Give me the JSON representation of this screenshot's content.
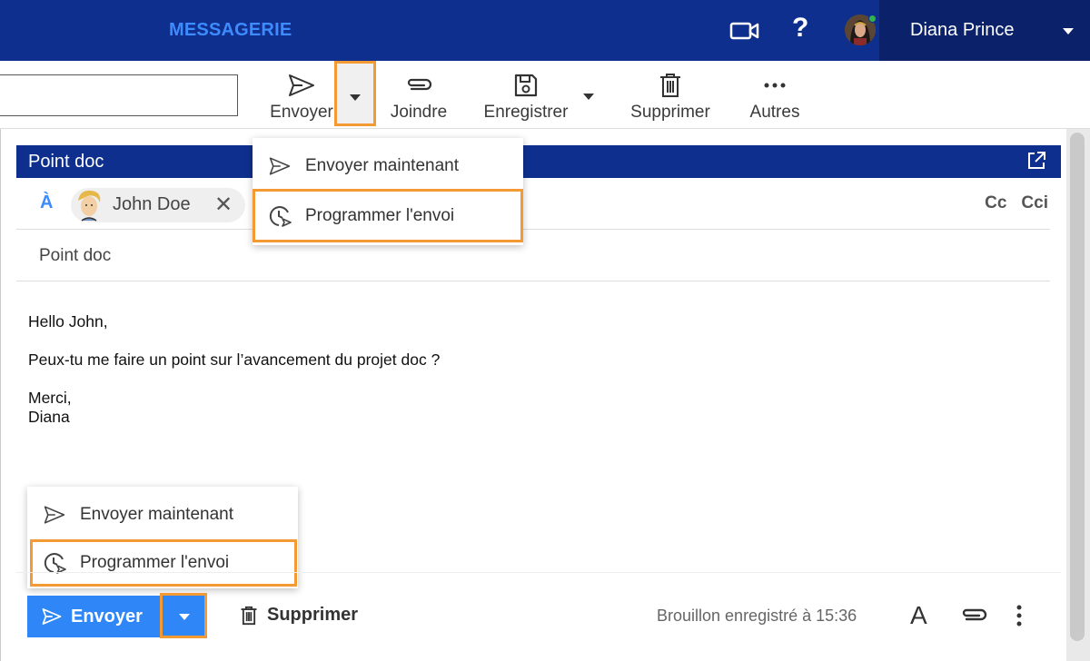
{
  "header": {
    "app_title": "MESSAGERIE",
    "help": "?",
    "user_name": "Diana Prince",
    "status_color": "#2fb34a",
    "brand_color": "#0f2f8f"
  },
  "toolbar": {
    "send_label": "Envoyer",
    "attach_label": "Joindre",
    "save_label": "Enregistrer",
    "delete_label": "Supprimer",
    "more_label": "Autres"
  },
  "send_menu_top": {
    "send_now": "Envoyer maintenant",
    "schedule": "Programmer l'envoi"
  },
  "compose": {
    "title": "Point doc",
    "to_label": "À",
    "recipient": "John Doe",
    "remove": "✕",
    "cc": "Cc",
    "bcc": "Cci",
    "subject": "Point doc",
    "body": {
      "line1": "Hello John,",
      "line2": "Peux-tu me faire un point sur l’avancement du projet doc ?",
      "line3": "Merci,",
      "line4": "Diana"
    }
  },
  "send_menu_bottom": {
    "send_now": "Envoyer maintenant",
    "schedule": "Programmer l'envoi"
  },
  "footer": {
    "send_label": "Envoyer",
    "delete_label": "Supprimer",
    "draft_status": "Brouillon enregistré à 15:36",
    "format_icon": "A"
  }
}
